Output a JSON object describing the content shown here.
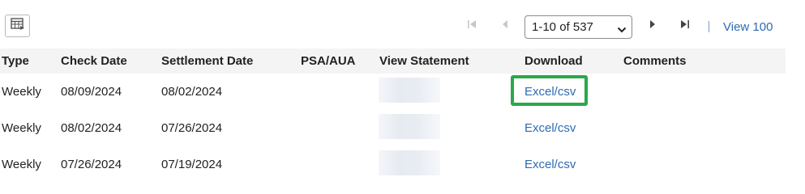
{
  "toolbar": {
    "grid_button_icon": "table-settings-icon",
    "pager": {
      "first_icon": "first-page-icon",
      "prev_icon": "previous-page-icon",
      "next_icon": "next-page-icon",
      "last_icon": "last-page-icon",
      "range_label": "1-10 of 537",
      "view_all_label": "View 100"
    }
  },
  "table": {
    "columns": [
      "Type",
      "Check Date",
      "Settlement Date",
      "PSA/AUA",
      "View Statement",
      "Download",
      "Comments"
    ],
    "rows": [
      {
        "type": "Weekly",
        "check_date": "08/09/2024",
        "settlement_date": "08/02/2024",
        "psa_aua": "",
        "download": "Excel/csv",
        "comments": ""
      },
      {
        "type": "Weekly",
        "check_date": "08/02/2024",
        "settlement_date": "07/26/2024",
        "psa_aua": "",
        "download": "Excel/csv",
        "comments": ""
      },
      {
        "type": "Weekly",
        "check_date": "07/26/2024",
        "settlement_date": "07/19/2024",
        "psa_aua": "",
        "download": "Excel/csv",
        "comments": ""
      }
    ]
  },
  "colors": {
    "link": "#2e6bb0",
    "highlight": "#2ba84a",
    "header_bg": "#f4f4f4"
  }
}
